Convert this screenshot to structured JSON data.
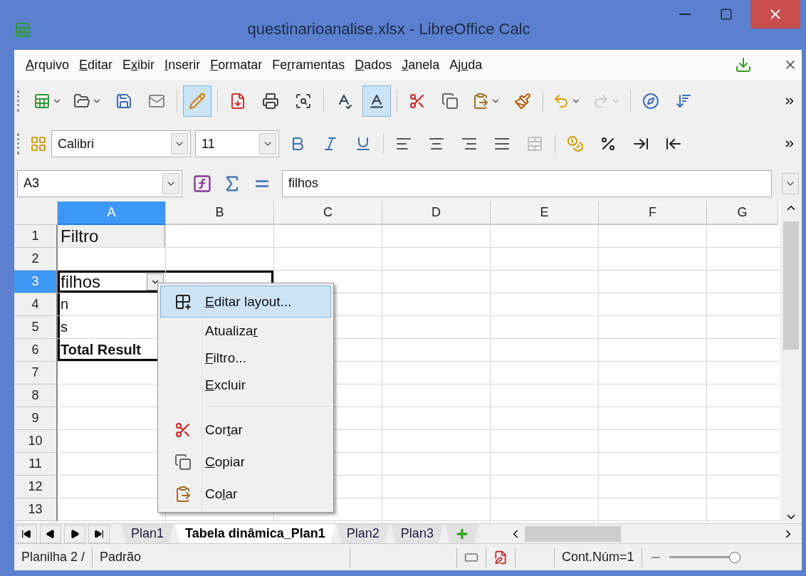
{
  "window": {
    "title": "questinarioanalise.xlsx - LibreOffice Calc"
  },
  "menu": [
    {
      "key": "A",
      "after": "rquivo"
    },
    {
      "key": "E",
      "after": "ditar"
    },
    {
      "before": "E",
      "key": "x",
      "after": "ibir"
    },
    {
      "key": "I",
      "after": "nserir"
    },
    {
      "key": "F",
      "after": "ormatar"
    },
    {
      "before": "Fe",
      "key": "r",
      "after": "ramentas"
    },
    {
      "key": "D",
      "after": "ados"
    },
    {
      "key": "J",
      "after": "anela"
    },
    {
      "before": "Aj",
      "key": "u",
      "after": "da"
    }
  ],
  "toolbar_1": [
    {
      "kind": "split",
      "on": false,
      "disabled": false
    },
    {
      "kind": "split",
      "on": false,
      "disabled": false
    },
    {
      "kind": "button",
      "on": false,
      "disabled": false
    },
    {
      "kind": "button",
      "on": false,
      "disabled": false
    },
    {
      "kind": "sep"
    },
    {
      "kind": "button",
      "on": true,
      "disabled": false
    },
    {
      "kind": "sep"
    },
    {
      "kind": "button",
      "on": false,
      "disabled": false
    },
    {
      "kind": "button",
      "on": false,
      "disabled": false
    },
    {
      "kind": "button",
      "on": false,
      "disabled": false
    },
    {
      "kind": "sep"
    },
    {
      "kind": "button",
      "on": false,
      "disabled": false
    },
    {
      "kind": "button",
      "on": true,
      "disabled": false
    },
    {
      "kind": "sep"
    },
    {
      "kind": "button",
      "on": false,
      "disabled": false
    },
    {
      "kind": "button",
      "on": false,
      "disabled": false
    },
    {
      "kind": "split",
      "on": false,
      "disabled": false
    },
    {
      "kind": "button",
      "on": false,
      "disabled": false
    },
    {
      "kind": "sep"
    },
    {
      "kind": "split",
      "on": false,
      "disabled": false
    },
    {
      "kind": "split",
      "on": false,
      "disabled": true
    },
    {
      "kind": "sep"
    },
    {
      "kind": "button",
      "on": false,
      "disabled": false
    },
    {
      "kind": "button",
      "on": false,
      "disabled": false
    }
  ],
  "toolbar_2": {
    "font": "Calibri",
    "size": "11",
    "buttons": [
      {
        "kind": "button",
        "on": false,
        "disabled": false
      },
      {
        "kind": "button",
        "on": false,
        "disabled": false
      },
      {
        "kind": "button",
        "on": false,
        "disabled": false
      },
      {
        "kind": "sep"
      },
      {
        "kind": "button",
        "on": false,
        "disabled": false
      },
      {
        "kind": "button",
        "on": false,
        "disabled": false
      },
      {
        "kind": "button",
        "on": false,
        "disabled": false
      },
      {
        "kind": "button",
        "on": false,
        "disabled": false
      },
      {
        "kind": "button",
        "on": false,
        "disabled": true
      },
      {
        "kind": "sep"
      },
      {
        "kind": "button",
        "on": false,
        "disabled": false
      },
      {
        "kind": "button",
        "on": false,
        "disabled": false
      },
      {
        "kind": "button",
        "on": false,
        "disabled": false
      },
      {
        "kind": "button",
        "on": false,
        "disabled": false
      }
    ]
  },
  "formula_bar": {
    "cell": "A3",
    "value": "filhos"
  },
  "columns": [
    {
      "label": "A",
      "selected": true
    },
    {
      "label": "B",
      "selected": false
    },
    {
      "label": "C",
      "selected": false
    },
    {
      "label": "D",
      "selected": false
    },
    {
      "label": "E",
      "selected": false
    },
    {
      "label": "F",
      "selected": false
    },
    {
      "label": "G",
      "selected": false
    }
  ],
  "rows": [
    {
      "label": "1",
      "selected": false,
      "cells": [
        {
          "text": "Filtro",
          "kind": "filter"
        }
      ]
    },
    {
      "label": "2",
      "selected": false,
      "cells": []
    },
    {
      "label": "3",
      "selected": true,
      "cells": [
        {
          "text": "filhos",
          "kind": "field"
        },
        {
          "kind": "field_blank"
        }
      ]
    },
    {
      "label": "4",
      "selected": false,
      "cells": [
        {
          "text": "n",
          "kind": "item"
        }
      ]
    },
    {
      "label": "5",
      "selected": false,
      "cells": [
        {
          "text": "s",
          "kind": "item"
        }
      ]
    },
    {
      "label": "6",
      "selected": false,
      "cells": [
        {
          "text": "Total Result",
          "kind": "total"
        }
      ]
    },
    {
      "label": "7",
      "selected": false,
      "cells": []
    },
    {
      "label": "8",
      "selected": false,
      "cells": []
    },
    {
      "label": "9",
      "selected": false,
      "cells": []
    },
    {
      "label": "10",
      "selected": false,
      "cells": []
    },
    {
      "label": "11",
      "selected": false,
      "cells": []
    },
    {
      "label": "12",
      "selected": false,
      "cells": []
    },
    {
      "label": "13",
      "selected": false,
      "cells": []
    }
  ],
  "context_menu": [
    {
      "kind": "item",
      "key": "E",
      "after": "ditar layout...",
      "selected": true
    },
    {
      "kind": "item",
      "before": "Atualiza",
      "key": "r",
      "selected": false
    },
    {
      "kind": "item",
      "key": "F",
      "after": "iltro...",
      "selected": false
    },
    {
      "kind": "item",
      "key": "E",
      "after": "xcluir",
      "selected": false
    },
    {
      "kind": "sep"
    },
    {
      "kind": "item",
      "before": "Cor",
      "key": "t",
      "after": "ar",
      "selected": false
    },
    {
      "kind": "item",
      "key": "C",
      "after": "opiar",
      "selected": false
    },
    {
      "kind": "item",
      "before": "Co",
      "key": "l",
      "after": "ar",
      "selected": false
    }
  ],
  "sheet_tabs": [
    {
      "label": "Plan1",
      "selected": false
    },
    {
      "label": "Tabela dinâmica_Plan1",
      "selected": true
    },
    {
      "label": "Plan2",
      "selected": false
    },
    {
      "label": "Plan3",
      "selected": false
    }
  ],
  "status_bar": {
    "sheet": "Planilha 2 /",
    "style": "Padrão",
    "count": "Cont.Núm=1",
    "zoom": {
      "level": 1
    }
  }
}
